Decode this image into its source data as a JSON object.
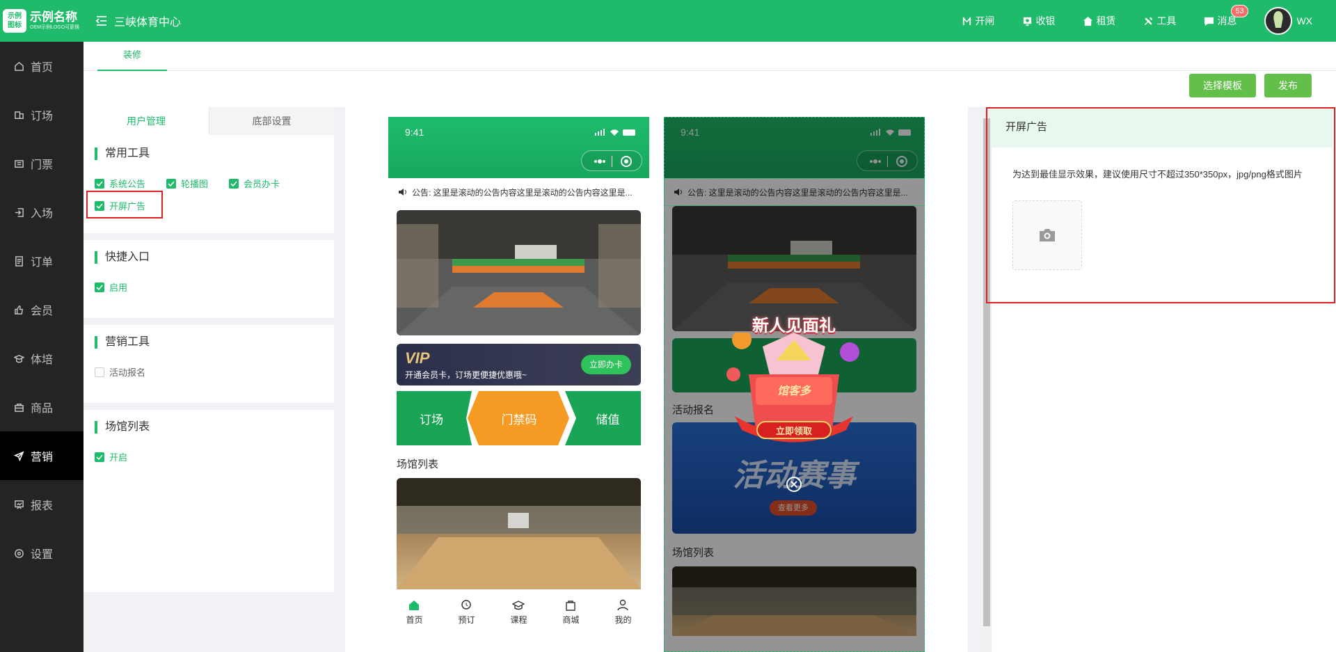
{
  "logo": {
    "mark_top": "示例",
    "mark_bottom": "图标",
    "name": "示例名称",
    "sub": "OEM示例LOGO可更换"
  },
  "header": {
    "venue": "三峡体育中心"
  },
  "top_actions": [
    {
      "label": "开闸",
      "icon": "gate-icon"
    },
    {
      "label": "收银",
      "icon": "cashier-icon"
    },
    {
      "label": "租赁",
      "icon": "home-icon"
    },
    {
      "label": "工具",
      "icon": "tools-icon"
    },
    {
      "label": "消息",
      "icon": "message-icon",
      "badge": "53"
    }
  ],
  "user": {
    "name": "WX"
  },
  "sidebar": {
    "items": [
      {
        "label": "首页",
        "icon": "home-icon"
      },
      {
        "label": "订场",
        "icon": "booking-icon"
      },
      {
        "label": "门票",
        "icon": "ticket-icon"
      },
      {
        "label": "入场",
        "icon": "enter-icon"
      },
      {
        "label": "订单",
        "icon": "order-icon"
      },
      {
        "label": "会员",
        "icon": "member-icon"
      },
      {
        "label": "体培",
        "icon": "training-icon"
      },
      {
        "label": "商品",
        "icon": "goods-icon"
      },
      {
        "label": "营销",
        "icon": "marketing-icon",
        "active": true
      },
      {
        "label": "报表",
        "icon": "report-icon"
      },
      {
        "label": "设置",
        "icon": "settings-icon"
      }
    ]
  },
  "page": {
    "tab": "装修",
    "btn_template": "选择模板",
    "btn_publish": "发布"
  },
  "left_panel": {
    "tabs": [
      "用户管理",
      "底部设置"
    ],
    "groups": [
      {
        "title": "常用工具",
        "items": [
          {
            "label": "系统公告",
            "checked": true
          },
          {
            "label": "轮播图",
            "checked": true
          },
          {
            "label": "会员办卡",
            "checked": true
          },
          {
            "label": "开屏广告",
            "checked": true
          }
        ]
      },
      {
        "title": "快捷入口",
        "items": [
          {
            "label": "启用",
            "checked": true
          }
        ]
      },
      {
        "title": "营销工具",
        "items": [
          {
            "label": "活动报名",
            "checked": false
          }
        ]
      },
      {
        "title": "场馆列表",
        "items": [
          {
            "label": "开启",
            "checked": true
          }
        ]
      }
    ]
  },
  "preview": {
    "time": "9:41",
    "notice": "公告: 这里是滚动的公告内容这里是滚动的公告内容这里是...",
    "vip_logo": "VIP",
    "vip_text": "开通会员卡，订场更便捷优惠哦~",
    "vip_btn": "立即办卡",
    "entries": [
      "订场",
      "门禁码",
      "储值"
    ],
    "venue_list": "场馆列表",
    "activity": "活动报名",
    "activity_banner": "活动赛事",
    "activity_more": "查看更多",
    "ad_title": "新人见面礼",
    "ad_tag": "馆客多",
    "ad_btn": "立即领取",
    "tabbar": [
      {
        "label": "首页",
        "icon": "home-icon"
      },
      {
        "label": "预订",
        "icon": "clock-icon"
      },
      {
        "label": "课程",
        "icon": "course-icon"
      },
      {
        "label": "商城",
        "icon": "bag-icon"
      },
      {
        "label": "我的",
        "icon": "user-icon"
      }
    ]
  },
  "right_panel": {
    "title": "开屏广告",
    "tip": "为达到最佳显示效果，建议使用尺寸不超过350*350px，jpg/png格式图片"
  },
  "colors": {
    "brand": "#1fbb6b",
    "highlight": "#e02020",
    "sidebar": "#242424"
  }
}
